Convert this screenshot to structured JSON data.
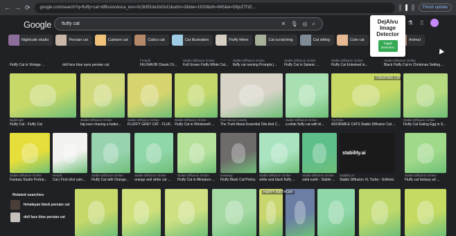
{
  "browser": {
    "url": "google.com/search?q=fluffy+cat+diffusion&sca_esv=0c3b5f1de1b01d1&udm=2&biw=1920&bih=945&ei=D6jvZ7f1E...",
    "finish_update": "Finish update"
  },
  "google": {
    "logo": "Google",
    "query": "fluffy cat"
  },
  "chips": [
    {
      "label": "Nightcafe studio",
      "color": "#8d6e9b"
    },
    {
      "label": "Persian cat",
      "color": "#c9b8a8"
    },
    {
      "label": "Cartoon cat",
      "color": "#f0c27a"
    },
    {
      "label": "Calico cat",
      "color": "#b3896a"
    },
    {
      "label": "Cat illustration",
      "color": "#9ecbe3"
    },
    {
      "label": "Fluffy feline",
      "color": "#d8cfc4"
    },
    {
      "label": "Cat scratching",
      "color": "#a7b19a"
    },
    {
      "label": "Cat sitting",
      "color": "#7e8a96"
    },
    {
      "label": "Cute cat",
      "color": "#e6b995"
    },
    {
      "label": "Fu",
      "color": "#c1c58a"
    },
    {
      "label": "Animal",
      "color": "#b98f70"
    }
  ],
  "popup": {
    "title_lines": [
      "DejAIvu",
      "Image",
      "Detector"
    ],
    "toggle_lines": [
      "Toggle",
      "Detection"
    ]
  },
  "row0_captions": [
    {
      "src": "",
      "title": "Fluffy Cat in Vintage ..."
    },
    {
      "src": "",
      "title": "doll face blue eyes persian cat"
    },
    {
      "src": "Freepik",
      "title": "FELINAVIB Classic Di..."
    },
    {
      "src": "Stable Diffusion Online",
      "title": "Full Grown Fluffy White Cat..."
    },
    {
      "src": "Stable Diffusion Online",
      "title": "fluffy cat running Prompts |..."
    },
    {
      "src": "Stable Diffusion Online",
      "title": "Fluffy Cat in Satanic ..."
    },
    {
      "src": "Stable Diffusion Online",
      "title": "Fluffy Cat Entwined in..."
    },
    {
      "src": "Stable Diffusion Online",
      "title": "Black Fluffy Cat in Christmas Setting ..."
    }
  ],
  "row1": [
    {
      "src": "NightCafe",
      "title": "Fluffy Cat - Fluffy Cat",
      "color": "#c8d96a"
    },
    {
      "src": "Stable Diffusion Online",
      "title": "big ears chasing a butter...",
      "color": "#cfd97a"
    },
    {
      "src": "Stable Diffusion Online",
      "title": "FLUFFY GREY CAT - FLUF...",
      "color": "#d6d46f"
    },
    {
      "src": "Stable Diffusion Online",
      "title": "Fluffy Cat in Windowsill ...",
      "color": "#c2d86b"
    },
    {
      "src": "Purr Nicely Hostels",
      "title": "The Truth About Essential Oils And C...",
      "color": "#d7d3c7"
    },
    {
      "src": "Stable Diffusion Online",
      "title": "a white fluffy cat with bl...",
      "color": "#a9e0b1"
    },
    {
      "src": "YouTube",
      "title": "ADORABLE CATS Stable Diffusion Cat ...",
      "color": "#c7d864"
    },
    {
      "src": "Stable Diffusion Online",
      "title": "Fluffy Cat Eating Egg in S...",
      "color": "#b4d97f"
    }
  ],
  "row2": [
    {
      "src": "Stable Diffusion Online",
      "title": "Fantasy Studio Portrai...",
      "color": "#e6de3b"
    },
    {
      "src": "Reddit",
      "title": "Cat | First shot usin...",
      "color": "#f2f2f0"
    },
    {
      "src": "Stable Diffusion Online",
      "title": "Fluffy Cat with Orange...",
      "color": "#98d3b0"
    },
    {
      "src": "Stable Diffusion Online",
      "title": "orange and white cat ...",
      "color": "#8fd6a8"
    },
    {
      "src": "Stable Diffusion Online",
      "title": "Fluffy Cat in Miniature ...",
      "color": "#b5e09a"
    },
    {
      "src": "Getaway",
      "title": "Fluffy Black Cat Portra...",
      "color": "#6e6b6a"
    },
    {
      "src": "Stable Diffusion Online",
      "title": "white and black fluffy ...",
      "color": "#a9e3c0"
    },
    {
      "src": "Stable Diffusion Online",
      "title": "solid earth - Stable ...",
      "color": "#5fbf8a"
    },
    {
      "src": "Stability AI",
      "title": "Stable Diffusion XL Turbo - Softonic",
      "color": "#1a1a1a"
    },
    {
      "src": "Stable Diffusion Online",
      "title": "Fluffy cat fantasy art ...",
      "color": "#9fd989"
    }
  ],
  "stability_label": "stability.ai",
  "related": {
    "heading": "Related searches",
    "items": [
      {
        "label": "himalayan black persian cat",
        "color": "#4a3f38"
      },
      {
        "label": "doll face blue persian cat",
        "color": "#c6c0ba"
      }
    ]
  },
  "row3_labels": {
    "happy_birthday": "HAPPY BIRTHDAY"
  },
  "creating_label": "CREATING CAT",
  "colors": {
    "background": "#202124",
    "accent_green": "#34a853",
    "link_blue": "#8ab4f8"
  }
}
